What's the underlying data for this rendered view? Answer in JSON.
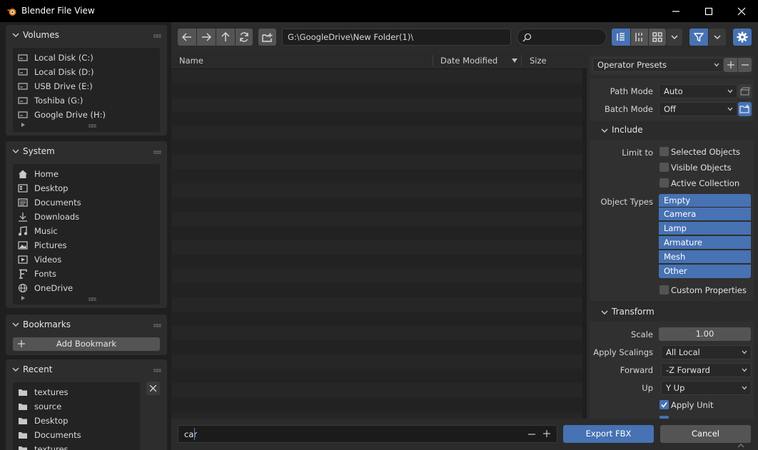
{
  "window": {
    "title": "Blender File View"
  },
  "sidebar": {
    "volumes": {
      "title": "Volumes",
      "items": [
        {
          "label": "Local Disk (C:)",
          "icon": "disk-icon"
        },
        {
          "label": "Local Disk (D:)",
          "icon": "disk-icon"
        },
        {
          "label": "USB Drive (E:)",
          "icon": "disk-icon"
        },
        {
          "label": "Toshiba (G:)",
          "icon": "disk-icon"
        },
        {
          "label": "Google Drive (H:)",
          "icon": "disk-icon"
        }
      ]
    },
    "system": {
      "title": "System",
      "items": [
        {
          "label": "Home",
          "icon": "home-icon"
        },
        {
          "label": "Desktop",
          "icon": "desktop-icon"
        },
        {
          "label": "Documents",
          "icon": "documents-icon"
        },
        {
          "label": "Downloads",
          "icon": "download-icon"
        },
        {
          "label": "Music",
          "icon": "music-icon"
        },
        {
          "label": "Pictures",
          "icon": "pictures-icon"
        },
        {
          "label": "Videos",
          "icon": "videos-icon"
        },
        {
          "label": "Fonts",
          "icon": "fonts-icon"
        },
        {
          "label": "OneDrive",
          "icon": "globe-icon"
        }
      ]
    },
    "bookmarks": {
      "title": "Bookmarks",
      "add_label": "Add Bookmark"
    },
    "recent": {
      "title": "Recent",
      "items": [
        {
          "label": "textures",
          "icon": "folder-icon"
        },
        {
          "label": "source",
          "icon": "folder-icon"
        },
        {
          "label": "Desktop",
          "icon": "folder-icon"
        },
        {
          "label": "Documents",
          "icon": "folder-icon"
        },
        {
          "label": "textures",
          "icon": "folder-icon"
        }
      ]
    }
  },
  "toolbar": {
    "path": "G:\\GoogleDrive\\New Folder(1)\\",
    "search_placeholder": ""
  },
  "columns": {
    "name": "Name",
    "date": "Date Modified",
    "size": "Size"
  },
  "bottom": {
    "filename": "car",
    "export_label": "Export FBX",
    "cancel_label": "Cancel"
  },
  "settings": {
    "presets_label": "Operator Presets",
    "path_mode": {
      "label": "Path Mode",
      "value": "Auto"
    },
    "batch_mode": {
      "label": "Batch Mode",
      "value": "Off"
    },
    "include": {
      "title": "Include",
      "limit_to_label": "Limit to",
      "limits": [
        {
          "label": "Selected Objects",
          "checked": false
        },
        {
          "label": "Visible Objects",
          "checked": false
        },
        {
          "label": "Active Collection",
          "checked": false
        }
      ],
      "object_types_label": "Object Types",
      "object_types": [
        "Empty",
        "Camera",
        "Lamp",
        "Armature",
        "Mesh",
        "Other"
      ],
      "custom_properties": {
        "label": "Custom Properties",
        "checked": false
      }
    },
    "transform": {
      "title": "Transform",
      "scale": {
        "label": "Scale",
        "value": "1.00"
      },
      "apply_scalings": {
        "label": "Apply Scalings",
        "value": "All Local"
      },
      "forward": {
        "label": "Forward",
        "value": "-Z Forward"
      },
      "up": {
        "label": "Up",
        "value": "Y Up"
      },
      "apply_unit": {
        "label": "Apply Unit",
        "checked": true
      }
    }
  },
  "colors": {
    "accent": "#4772b3",
    "background": "#1d1d1d",
    "panel": "#2d2d2d"
  }
}
